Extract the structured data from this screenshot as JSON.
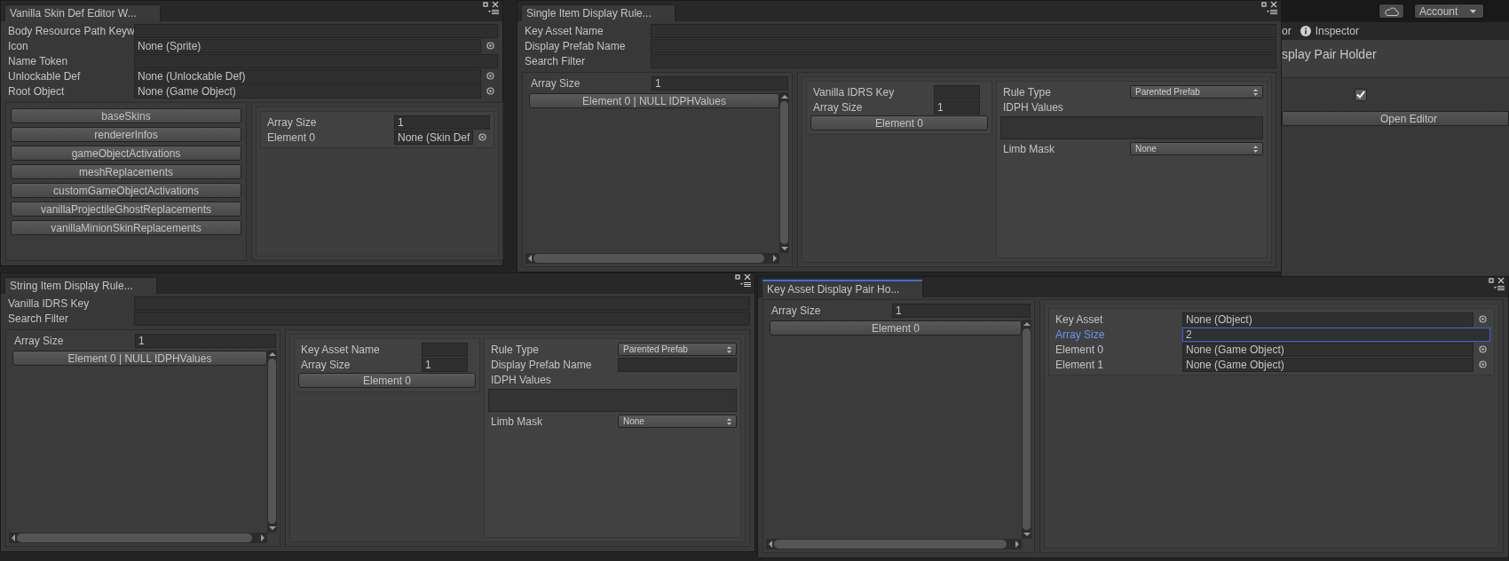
{
  "toolbar": {
    "account_button": "Account"
  },
  "inspector": {
    "tab_partial": "or",
    "tab": "Inspector",
    "title": "splay Pair Holder",
    "checkbox": {
      "checked": true
    },
    "open_button": "Open Editor"
  },
  "windows": [
    {
      "tab": "Vanilla Skin Def Editor W...",
      "focused": false,
      "fields": [
        {
          "kind": "text",
          "label": "Body Resource Path Keyw"
        },
        {
          "kind": "object",
          "label": "Icon",
          "value": "None (Sprite)"
        },
        {
          "kind": "text",
          "label": "Name Token"
        },
        {
          "kind": "object",
          "label": "Unlockable Def",
          "value": "None (Unlockable Def)"
        },
        {
          "kind": "object",
          "label": "Root Object",
          "value": "None (Game Object)"
        }
      ],
      "left": {
        "kind": "buttons",
        "rows": [
          {
            "kind": "button",
            "label": "baseSkins"
          },
          {
            "kind": "button",
            "label": "rendererInfos"
          },
          {
            "kind": "button",
            "label": "gameObjectActivations"
          },
          {
            "kind": "button",
            "label": "meshReplacements"
          },
          {
            "kind": "button",
            "label": "customGameObjectActivations"
          },
          {
            "kind": "button",
            "label": "vanillaProjectileGhostReplacements"
          },
          {
            "kind": "button",
            "label": "vanillaMinionSkinReplacements"
          }
        ]
      },
      "right": {
        "boxes": [
          {
            "rows": [
              {
                "kind": "text",
                "label": "Array Size",
                "value": "1"
              },
              {
                "kind": "object",
                "label": "Element 0",
                "value": "None (Skin Def"
              }
            ]
          }
        ]
      }
    },
    {
      "tab": "Single Item Display Rule...",
      "focused": false,
      "fields": [
        {
          "kind": "text",
          "label": "Key Asset Name"
        },
        {
          "kind": "text",
          "label": "Display Prefab Name"
        },
        {
          "kind": "text",
          "label": "Search Filter"
        }
      ],
      "left": {
        "kind": "scroll",
        "header": [
          {
            "kind": "text",
            "label": "Array Size",
            "value": "1"
          }
        ],
        "rows": [
          {
            "kind": "button",
            "label": "Element 0 | NULL IDPHValues"
          }
        ]
      },
      "right": {
        "boxes": [
          {
            "rows": [
              {
                "kind": "text",
                "label": "Vanilla IDRS Key"
              },
              {
                "kind": "text",
                "label": "Array Size",
                "value": "1"
              },
              {
                "kind": "button",
                "label": "Element 0"
              }
            ]
          },
          {
            "rows": [
              {
                "kind": "dropdown",
                "label": "Rule Type",
                "value": "Parented Prefab"
              },
              {
                "kind": "heading",
                "label": "IDPH Values"
              },
              {
                "kind": "area"
              },
              {
                "kind": "dropdown",
                "label": "Limb Mask",
                "value": "None"
              }
            ]
          }
        ]
      }
    },
    {
      "tab": "String Item Display Rule...",
      "focused": false,
      "fields": [
        {
          "kind": "text",
          "label": "Vanilla IDRS Key"
        },
        {
          "kind": "text",
          "label": "Search Filter"
        }
      ],
      "left": {
        "kind": "scroll",
        "header": [
          {
            "kind": "text",
            "label": "Array Size",
            "value": "1"
          }
        ],
        "rows": [
          {
            "kind": "button",
            "label": "Element 0 | NULL IDPHValues"
          }
        ]
      },
      "right": {
        "boxes": [
          {
            "rows": [
              {
                "kind": "text",
                "label": "Key Asset Name"
              },
              {
                "kind": "text",
                "label": "Array Size",
                "value": "1"
              },
              {
                "kind": "button",
                "label": "Element 0"
              }
            ]
          },
          {
            "rows": [
              {
                "kind": "dropdown",
                "label": "Rule Type",
                "value": "Parented Prefab"
              },
              {
                "kind": "text",
                "label": "Display Prefab Name"
              },
              {
                "kind": "heading",
                "label": "IDPH Values"
              },
              {
                "kind": "area"
              },
              {
                "kind": "dropdown",
                "label": "Limb Mask",
                "value": "None"
              }
            ]
          }
        ]
      }
    },
    {
      "tab": "Key Asset Display Pair Ho...",
      "focused": true,
      "left": {
        "kind": "scroll",
        "header": [
          {
            "kind": "text",
            "label": "Array Size",
            "value": "1"
          }
        ],
        "rows": [
          {
            "kind": "button",
            "label": "Element 0"
          }
        ]
      },
      "right": {
        "boxes": [
          {
            "rows": [
              {
                "kind": "object",
                "label": "Key Asset",
                "value": "None (Object)",
                "focused": false
              },
              {
                "kind": "text",
                "label": "Array Size",
                "value": "2",
                "focused": true
              },
              {
                "kind": "object",
                "label": "Element 0",
                "value": "None (Game Object)",
                "focused": false
              },
              {
                "kind": "object",
                "label": "Element 1",
                "value": "None (Game Object)",
                "focused": false
              }
            ]
          }
        ]
      }
    }
  ]
}
